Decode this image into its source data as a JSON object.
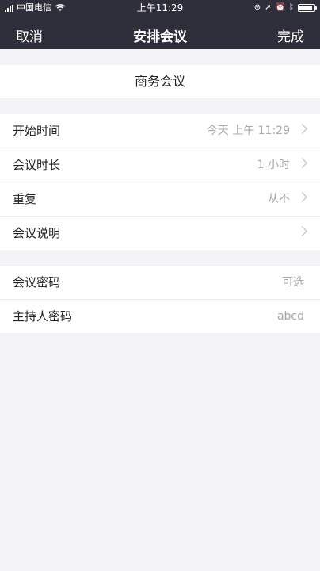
{
  "status_bar": {
    "carrier": "中国电信",
    "time": "上午11:29",
    "right_icons": [
      "screen-lock-rotation-icon",
      "location-arrow-icon",
      "alarm-icon",
      "bluetooth-icon",
      "battery-icon"
    ],
    "battery_level": 0.9
  },
  "nav": {
    "cancel_label": "取消",
    "title": "安排会议",
    "done_label": "完成"
  },
  "meeting": {
    "topic": "商务会议"
  },
  "settings": {
    "start_time": {
      "label": "开始时间",
      "value": "今天 上午 11:29"
    },
    "duration": {
      "label": "会议时长",
      "value": "1 小时"
    },
    "repeat": {
      "label": "重复",
      "value": "从不"
    },
    "description": {
      "label": "会议说明",
      "value": ""
    }
  },
  "passwords": {
    "meeting_password": {
      "label": "会议密码",
      "placeholder": "可选"
    },
    "host_password": {
      "label": "主持人密码",
      "value": "abcd"
    }
  },
  "colors": {
    "header_bg": "#2f2f3b",
    "page_bg": "#f4f4f6",
    "value_text": "#a6a6ab"
  }
}
